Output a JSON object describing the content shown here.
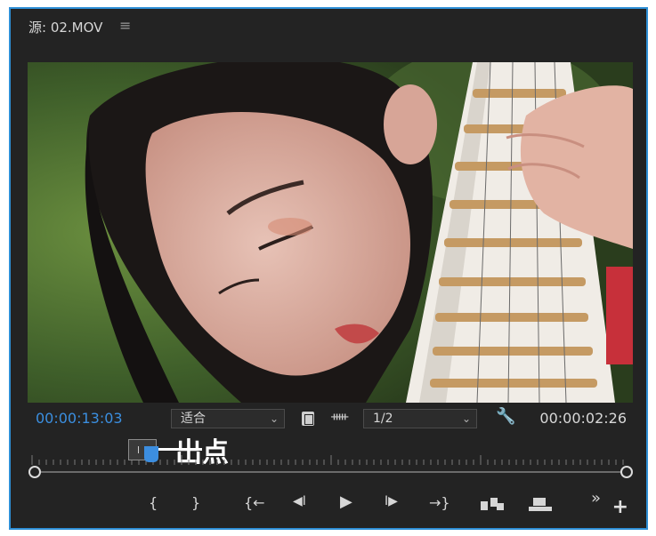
{
  "panel": {
    "title": "源: 02.MOV",
    "menu_icon": "hamburger-menu-icon"
  },
  "timecode": {
    "current": "00:00:13:03",
    "duration": "00:00:02:26"
  },
  "controls": {
    "zoom_fit": "适合",
    "resolution": "1/2"
  },
  "annotation": {
    "text": "出点"
  },
  "buttons": {
    "mark_in": "{",
    "mark_out": "}",
    "go_to_in": "{←",
    "step_back": "◀I",
    "play": "▶",
    "step_forward": "I▶",
    "go_to_out": "→}",
    "more": "»",
    "add": "+"
  },
  "colors": {
    "accent": "#3b8fe0",
    "panel_bg": "#232323",
    "border": "#2e8fd6"
  }
}
